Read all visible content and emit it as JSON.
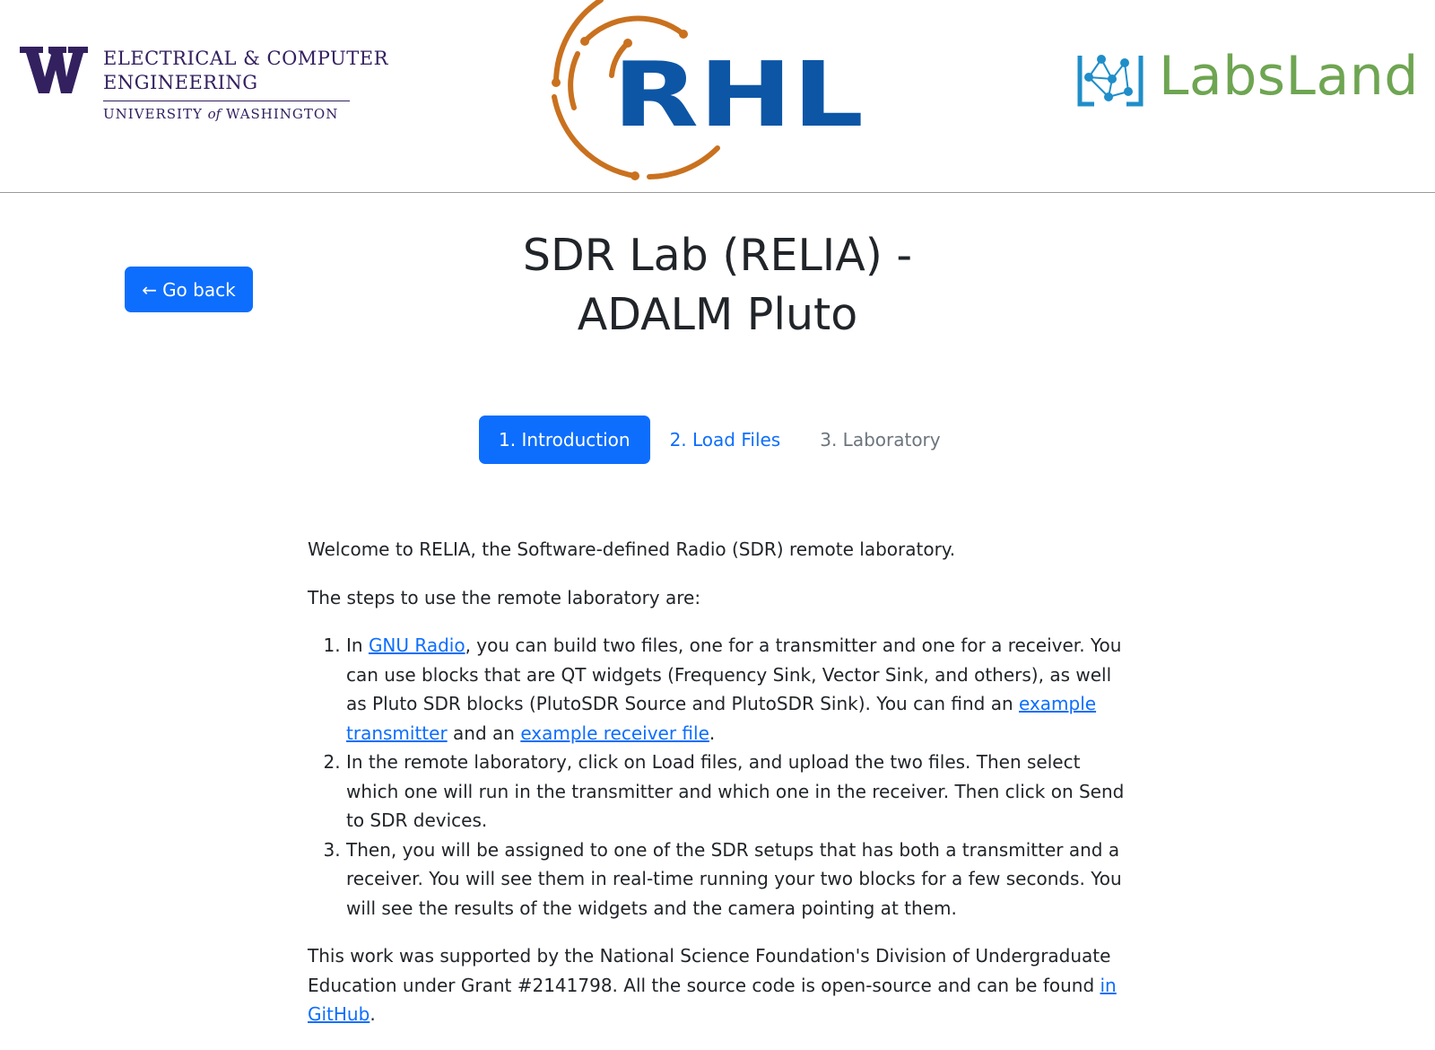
{
  "header": {
    "uw_logo": {
      "line1": "ELECTRICAL & COMPUTER",
      "line2": "ENGINEERING",
      "line3_a": "UNIVERSITY ",
      "line3_of": "of",
      "line3_b": " WASHINGTON",
      "color": "#33205f"
    },
    "rhl_logo": {
      "letters": "RHL",
      "blue": "#0d56a6",
      "orange": "#c9711f"
    },
    "labsland_logo": {
      "text": "LabsLand",
      "text_color": "#6ea552",
      "icon_color": "#1f8ec9"
    }
  },
  "nav": {
    "go_back_arrow": "←",
    "go_back_label": "Go back"
  },
  "title": {
    "line1": "SDR Lab (RELIA) -",
    "line2": "ADALM Pluto"
  },
  "tabs": [
    {
      "label": "1. Introduction",
      "state": "active"
    },
    {
      "label": "2. Load Files",
      "state": "link"
    },
    {
      "label": "3. Laboratory",
      "state": "muted"
    }
  ],
  "content": {
    "welcome": "Welcome to RELIA, the Software-defined Radio (SDR) remote laboratory.",
    "steps_intro": "The steps to use the remote laboratory are:",
    "step1": {
      "pre": "In ",
      "link_gnu": "GNU Radio",
      "mid": ", you can build two files, one for a transmitter and one for a receiver. You can use blocks that are QT widgets (Frequency Sink, Vector Sink, and others), as well as Pluto SDR blocks (PlutoSDR Source and PlutoSDR Sink). You can find an ",
      "link_tx": "example transmitter",
      "and": " and an ",
      "link_rx": "example receiver file",
      "end": "."
    },
    "step2": "In the remote laboratory, click on Load files, and upload the two files. Then select which one will run in the transmitter and which one in the receiver. Then click on Send to SDR devices.",
    "step3": "Then, you will be assigned to one of the SDR setups that has both a transmitter and a receiver. You will see them in real-time running your two blocks for a few seconds. You will see the results of the widgets and the camera pointing at them.",
    "footer": {
      "text": "This work was supported by the National Science Foundation's Division of Undergraduate Education under Grant #2141798. All the source code is open-source and can be found ",
      "link": "in GitHub",
      "end": "."
    }
  },
  "colors": {
    "primary": "#0d6efd",
    "muted": "#6c757d",
    "text": "#212529"
  }
}
